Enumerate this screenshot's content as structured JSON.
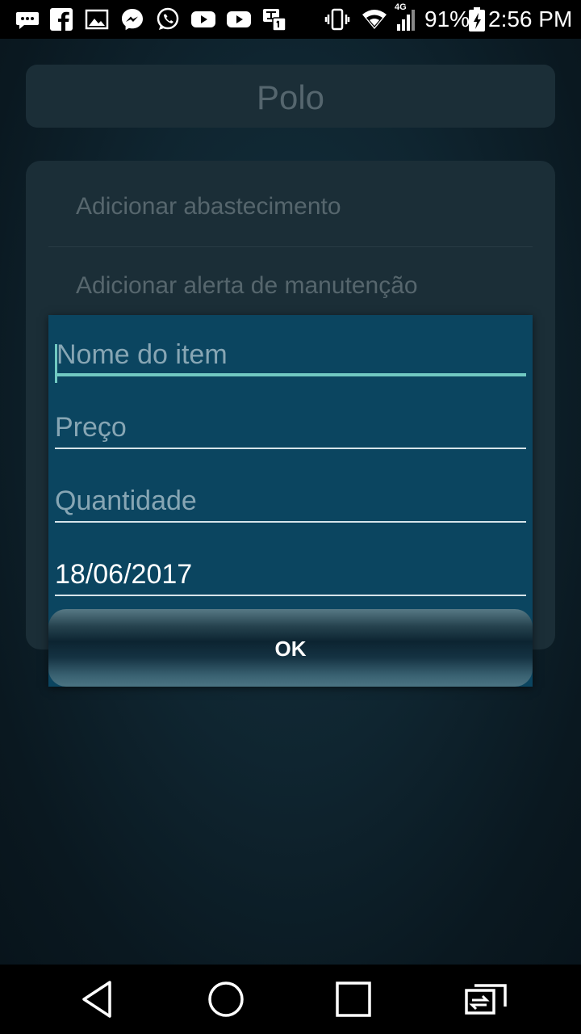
{
  "status_bar": {
    "battery_percent": "91%",
    "time": "2:56 PM",
    "network_type": "4G",
    "left_icons": [
      "messages-icon",
      "facebook-icon",
      "gallery-icon",
      "messenger-icon",
      "whatsapp-icon",
      "youtube-icon",
      "youtube-icon",
      "translate-notification-icon"
    ],
    "right_icons": [
      "vibrate-icon",
      "wifi-icon",
      "signal-icon",
      "battery-charging-icon"
    ]
  },
  "header": {
    "title": "Polo"
  },
  "menu": {
    "items": [
      {
        "label": "Adicionar abastecimento"
      },
      {
        "label": "Adicionar alerta de manutenção"
      }
    ]
  },
  "dialog": {
    "fields": [
      {
        "placeholder": "Nome do item",
        "value": ""
      },
      {
        "placeholder": "Preço",
        "value": ""
      },
      {
        "placeholder": "Quantidade",
        "value": ""
      },
      {
        "placeholder": "",
        "value": "18/06/2017"
      }
    ],
    "ok_label": "OK"
  },
  "nav_bar": {
    "buttons": [
      "back-icon",
      "home-icon",
      "recents-icon",
      "switch-app-icon"
    ]
  },
  "colors": {
    "dialog_bg": "#0b4560",
    "accent": "#71c9c2",
    "card_bg": "#1b2e37",
    "dim_text": "#56666d"
  }
}
